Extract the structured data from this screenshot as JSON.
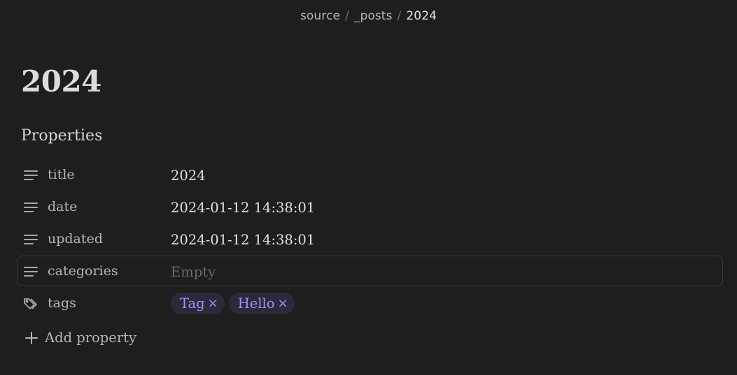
{
  "breadcrumb": {
    "parts": [
      "source",
      "_posts"
    ],
    "separator": "/",
    "current": "2024"
  },
  "page": {
    "title": "2024"
  },
  "properties": {
    "heading": "Properties",
    "rows": [
      {
        "name": "title",
        "value": "2024",
        "icon": "text-lines-icon"
      },
      {
        "name": "date",
        "value": "2024-01-12 14:38:01",
        "icon": "text-lines-icon"
      },
      {
        "name": "updated",
        "value": "2024-01-12 14:38:01",
        "icon": "text-lines-icon"
      },
      {
        "name": "categories",
        "placeholder": "Empty",
        "icon": "text-lines-icon"
      },
      {
        "name": "tags",
        "icon": "tags-icon",
        "tags": [
          "Tag",
          "Hello"
        ],
        "remove_glyph": "×"
      }
    ],
    "add_label": "Add property"
  },
  "colors": {
    "background": "#1e1e1e",
    "tag_text": "#a88bfa",
    "tag_background": "#2c2a3a"
  }
}
